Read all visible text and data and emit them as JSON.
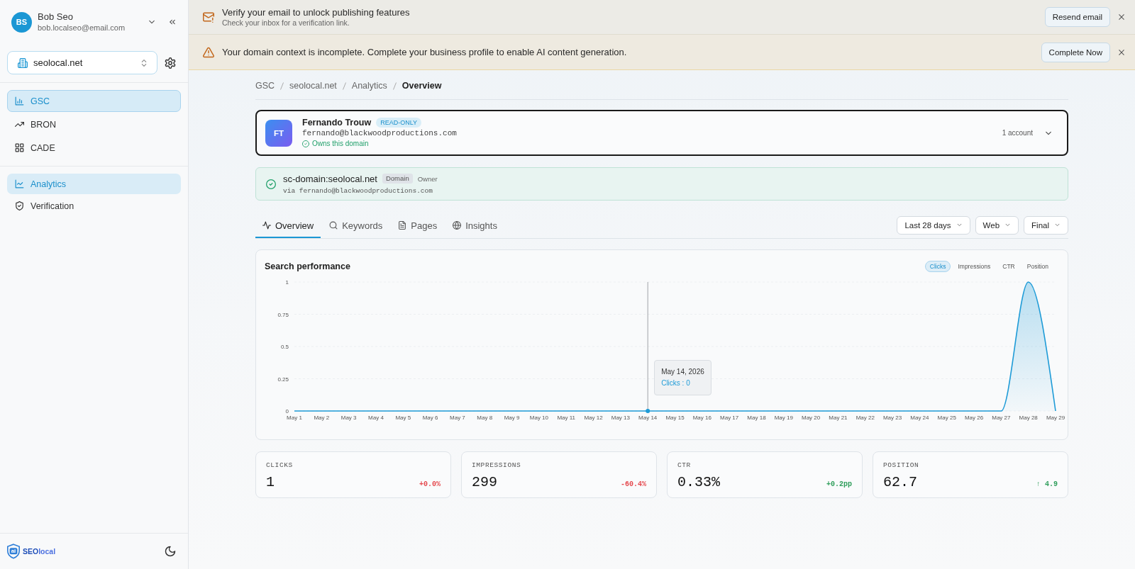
{
  "sidebar": {
    "user": {
      "initials": "BS",
      "name": "Bob Seo",
      "email": "bob.localseo@email.com"
    },
    "domain": {
      "value": "seolocal.net"
    },
    "nav": [
      {
        "label": "GSC",
        "selected": true
      },
      {
        "label": "BRON",
        "selected": false
      },
      {
        "label": "CADE",
        "selected": false
      }
    ],
    "subnav": [
      {
        "label": "Analytics",
        "selected": true
      },
      {
        "label": "Verification",
        "selected": false
      }
    ],
    "logo": {
      "mark": "ai",
      "name": "**SEO**local"
    }
  },
  "banners": [
    {
      "kind": "email",
      "title": "Verify your email to unlock publishing features",
      "subtitle": "Check your inbox for a verification link.",
      "button": "Resend email"
    },
    {
      "kind": "warning",
      "title": "Your domain context is incomplete. Complete your business profile to enable AI content generation.",
      "button": "Complete Now"
    }
  ],
  "breadcrumb": [
    {
      "label": "GSC",
      "current": false
    },
    {
      "label": "seolocal.net",
      "current": false
    },
    {
      "label": "Analytics",
      "current": false
    },
    {
      "label": "Overview",
      "current": true
    }
  ],
  "account": {
    "initials": "FT",
    "name": "Fernando Trouw",
    "badge": "READ-ONLY",
    "email": "fernando@blackwoodproductions.com",
    "status": "Owns this domain",
    "count": "1 account"
  },
  "property": {
    "name": "sc-domain:seolocal.net",
    "type": "Domain",
    "role": "Owner",
    "via": "via fernando@blackwoodproductions.com"
  },
  "tabs": [
    {
      "label": "Overview",
      "selected": true
    },
    {
      "label": "Keywords",
      "selected": false
    },
    {
      "label": "Pages",
      "selected": false
    },
    {
      "label": "Insights",
      "selected": false
    }
  ],
  "filters": [
    "Last 28 days",
    "Web",
    "Final"
  ],
  "performance": {
    "title": "Search performance",
    "toggles": [
      {
        "label": "Clicks",
        "selected": true
      },
      {
        "label": "Impressions",
        "selected": false
      },
      {
        "label": "CTR",
        "selected": false
      },
      {
        "label": "Position",
        "selected": false
      }
    ],
    "chart_data": {
      "type": "area",
      "categories": [
        "May 1",
        "May 2",
        "May 3",
        "May 4",
        "May 5",
        "May 6",
        "May 7",
        "May 8",
        "May 9",
        "May 10",
        "May 11",
        "May 12",
        "May 13",
        "May 14",
        "May 15",
        "May 16",
        "May 17",
        "May 18",
        "May 19",
        "May 20",
        "May 21",
        "May 22",
        "May 23",
        "May 24",
        "May 25",
        "May 26",
        "May 27",
        "May 28",
        "May 29"
      ],
      "values": [
        0,
        0,
        0,
        0,
        0,
        0,
        0,
        0,
        0,
        0,
        0,
        0,
        0,
        0,
        0,
        0,
        0,
        0,
        0,
        0,
        0,
        0,
        0,
        0,
        0,
        0,
        0,
        1,
        0
      ],
      "ylim": [
        0,
        1
      ],
      "yticks": [
        0,
        0.25,
        0.5,
        0.75,
        1
      ],
      "grid": true,
      "ref_lines": [
        {
          "axis": "x",
          "value": "May 14",
          "color": "#a0a4a8"
        }
      ],
      "annotations": [
        "May 14, 2026",
        "Clicks : 0"
      ]
    }
  },
  "metrics": [
    {
      "label": "CLICKS",
      "value": "1",
      "delta": "+0.0%",
      "color": "#e5484d"
    },
    {
      "label": "IMPRESSIONS",
      "value": "299",
      "delta": "-60.4%",
      "color": "#e5484d"
    },
    {
      "label": "CTR",
      "value": "0.33%",
      "delta": "+0.2pp",
      "color": "#2f9e5b"
    },
    {
      "label": "POSITION",
      "value": "62.7",
      "delta": "↑ 4.9",
      "color": "#2f9e5b"
    }
  ]
}
